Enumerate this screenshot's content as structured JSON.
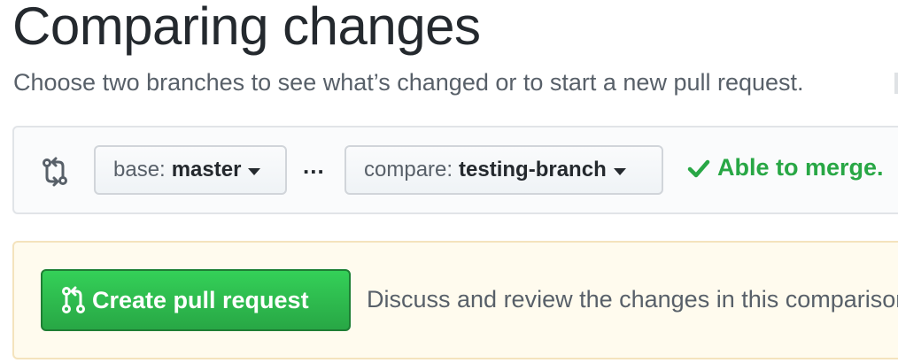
{
  "header": {
    "title": "Comparing changes",
    "subtitle": "Choose two branches to see what’s changed or to start a new pull request."
  },
  "range_editor": {
    "icon": "git-compare-icon",
    "base": {
      "prefix": "base:",
      "branch": "master"
    },
    "separator": "...",
    "compare": {
      "prefix": "compare:",
      "branch": "testing-branch"
    },
    "status": {
      "icon": "check-icon",
      "text": "Able to merge."
    }
  },
  "pull_request": {
    "button_icon": "git-pull-request-icon",
    "button_label": "Create pull request",
    "description": "Discuss and review the changes in this comparison with others."
  },
  "colors": {
    "success": "#28a745",
    "button_bg": "#2ea44f",
    "notice_bg": "#fffbee",
    "text_muted": "#586069"
  }
}
